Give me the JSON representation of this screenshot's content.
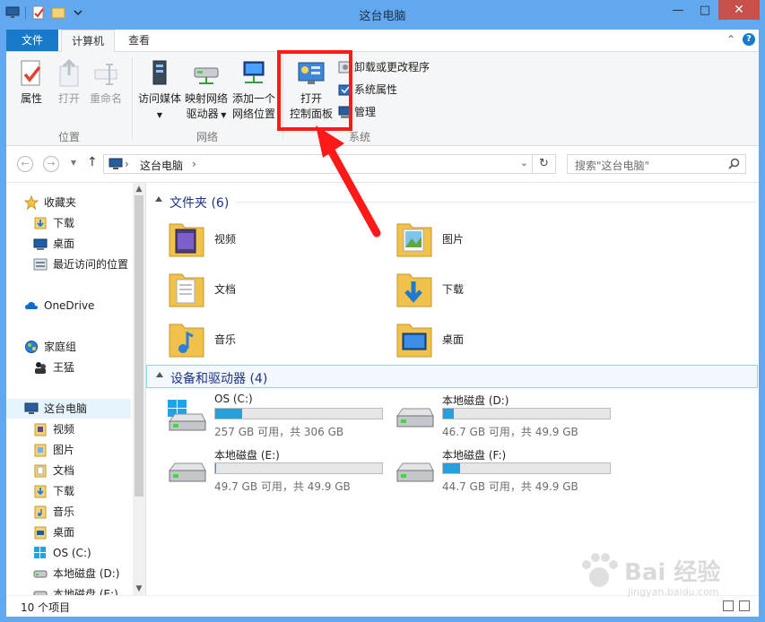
{
  "window": {
    "title": "这台电脑"
  },
  "ribbon_tabs": {
    "file": "文件",
    "computer": "计算机",
    "view": "查看"
  },
  "ribbon": {
    "location_group": {
      "label": "位置",
      "properties": "属性",
      "open": "打开",
      "rename": "重命名"
    },
    "network_group": {
      "label": "网络",
      "media_line1": "访问媒体",
      "map_line1": "映射网络",
      "map_line2": "驱动器",
      "add_line1": "添加一个",
      "add_line2": "网络位置"
    },
    "system_group": {
      "label": "系统",
      "open_line1": "打开",
      "open_line2": "控制面板",
      "uninstall": "卸载或更改程序",
      "system_properties": "系统属性",
      "manage": "管理"
    }
  },
  "address_bar": {
    "crumb": "这台电脑",
    "search_placeholder": "搜索\"这台电脑\""
  },
  "nav_pane": {
    "items": [
      {
        "label": "收藏夹",
        "icon": "star-icon"
      },
      {
        "label": "下载",
        "icon": "downloads-folder-icon"
      },
      {
        "label": "桌面",
        "icon": "desktop-icon"
      },
      {
        "label": "最近访问的位置",
        "icon": "recent-places-icon"
      },
      {
        "label": "OneDrive",
        "icon": "cloud-icon"
      },
      {
        "label": "家庭组",
        "icon": "homegroup-icon"
      },
      {
        "label": "王猛",
        "icon": "user-icon"
      },
      {
        "label": "这台电脑",
        "icon": "computer-icon"
      },
      {
        "label": "视频",
        "icon": "folder-icon"
      },
      {
        "label": "图片",
        "icon": "folder-icon"
      },
      {
        "label": "文档",
        "icon": "folder-icon"
      },
      {
        "label": "下载",
        "icon": "downloads-folder-icon"
      },
      {
        "label": "音乐",
        "icon": "folder-icon"
      },
      {
        "label": "桌面",
        "icon": "folder-icon"
      },
      {
        "label": "OS (C:)",
        "icon": "windows-drive-icon"
      },
      {
        "label": "本地磁盘 (D:)",
        "icon": "drive-icon"
      },
      {
        "label": "本地磁盘 (E:)",
        "icon": "drive-icon"
      }
    ]
  },
  "content": {
    "folders_header": "文件夹 (6)",
    "folders": [
      {
        "name": "视频"
      },
      {
        "name": "图片"
      },
      {
        "name": "文档"
      },
      {
        "name": "下载"
      },
      {
        "name": "音乐"
      },
      {
        "name": "桌面"
      }
    ],
    "drives_header": "设备和驱动器 (4)",
    "drives": [
      {
        "name": "OS (C:)",
        "stats": "257 GB 可用，共 306 GB",
        "used_fraction": 0.16
      },
      {
        "name": "本地磁盘 (D:)",
        "stats": "46.7 GB 可用，共 49.9 GB",
        "used_fraction": 0.064
      },
      {
        "name": "本地磁盘 (E:)",
        "stats": "49.7 GB 可用，共 49.9 GB",
        "used_fraction": 0.004
      },
      {
        "name": "本地磁盘 (F:)",
        "stats": "44.7 GB 可用，共 49.9 GB",
        "used_fraction": 0.104
      }
    ]
  },
  "status_bar": {
    "item_count": "10 个项目"
  },
  "watermark": {
    "text": "Bai 经验",
    "sub": "jingyan.baidu.com"
  },
  "colors": {
    "accent": "#1979ca",
    "highlight_box": "#ff1a1a",
    "drive_fill": "#26a0da",
    "window_frame": "#62a8ee"
  }
}
